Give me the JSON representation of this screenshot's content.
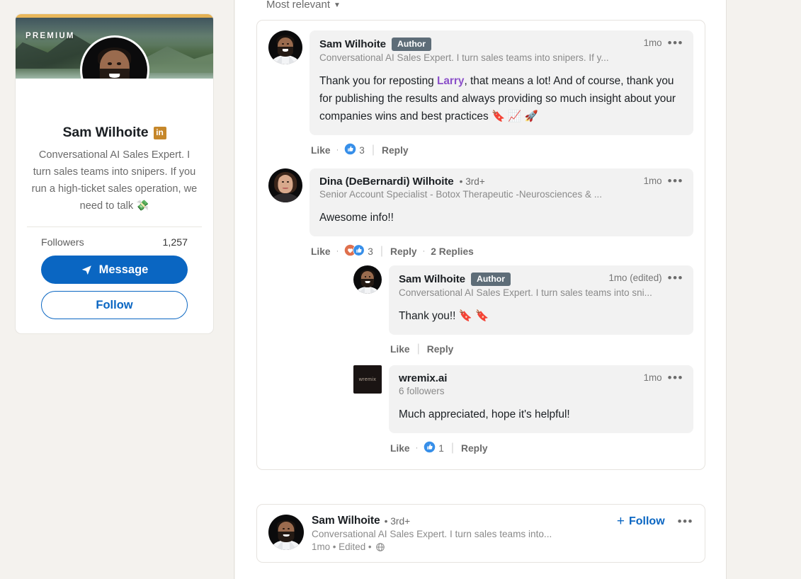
{
  "profile": {
    "premium_label": "PREMIUM",
    "name": "Sam Wilhoite",
    "premium_badge": "in",
    "headline": "Conversational AI Sales Expert. I turn sales teams into snipers. If you run a high-ticket sales operation, we need to talk 💸",
    "followers_label": "Followers",
    "followers_count": "1,257",
    "message_button": "Message",
    "follow_button": "Follow",
    "accent_color": "#0A66C2",
    "premium_color": "#E8B758"
  },
  "comments_panel": {
    "sort_label": "Most relevant",
    "sort_caret": "chevron-down-icon",
    "comments": [
      {
        "name": "Sam Wilhoite",
        "badge": "Author",
        "degree": "",
        "headline": "Conversational AI Sales Expert. I turn sales teams into snipers. If y...",
        "time": "1mo",
        "text_pre": "Thank you for reposting ",
        "mention": "Larry",
        "text_post": ", that means a lot! And of course, thank you for publishing the results and always providing so much insight about your companies wins and best practices 🔖 📈 🚀",
        "like_label": "Like",
        "reply_label": "Reply",
        "reaction_count": "3",
        "reactions": [
          "like-reaction-icon"
        ],
        "replies_label": ""
      },
      {
        "name": "Dina (DeBernardi) Wilhoite",
        "badge": "",
        "degree": "• 3rd+",
        "headline": "Senior Account Specialist - Botox Therapeutic -Neurosciences & ...",
        "time": "1mo",
        "text": "Awesome info!!",
        "like_label": "Like",
        "reply_label": "Reply",
        "reaction_count": "3",
        "reactions": [
          "love-reaction-icon",
          "like-reaction-icon"
        ],
        "replies_label": "2 Replies"
      }
    ],
    "nested_replies": [
      {
        "name": "Sam Wilhoite",
        "badge": "Author",
        "headline": "Conversational AI Sales Expert. I turn sales teams into sni...",
        "time": "1mo (edited)",
        "text": "Thank you!! 🔖 🔖",
        "like_label": "Like",
        "reply_label": "Reply",
        "reaction_count": "",
        "avatar": "photo"
      },
      {
        "name": "wremix.ai",
        "badge": "",
        "headline": "6 followers",
        "time": "1mo",
        "text": "Much appreciated, hope it's helpful!",
        "like_label": "Like",
        "reply_label": "Reply",
        "reaction_count": "1",
        "avatar": "logo",
        "logo_text": "wremix"
      }
    ]
  },
  "post": {
    "name": "Sam Wilhoite",
    "degree": "• 3rd+",
    "headline": "Conversational AI Sales Expert. I turn sales teams into...",
    "meta": "1mo • Edited •",
    "visibility_icon": "globe-icon",
    "follow_label": "Follow",
    "menu_icon": "ellipsis-icon"
  }
}
